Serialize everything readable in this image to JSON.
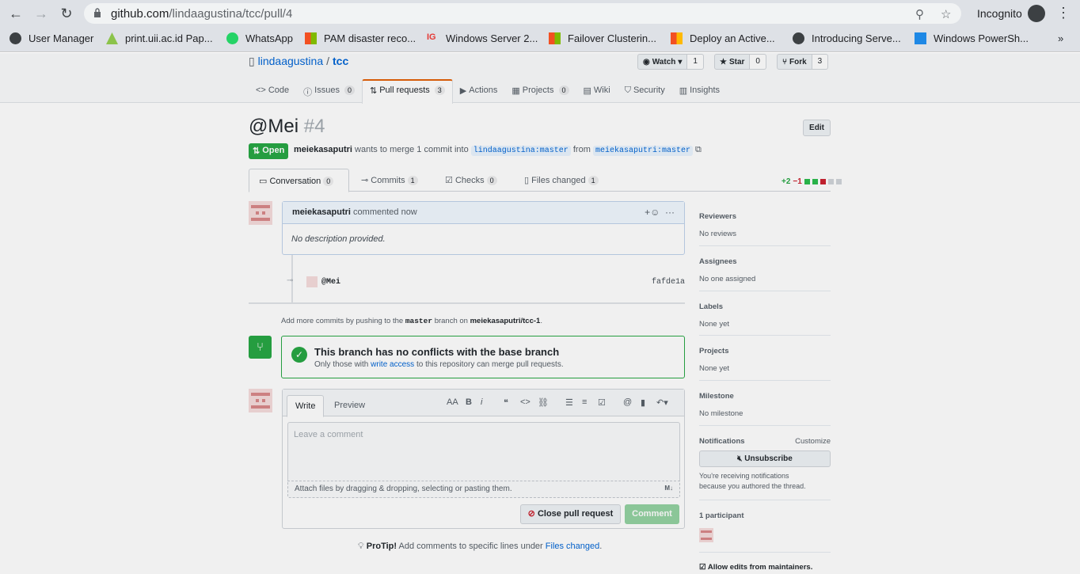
{
  "browser": {
    "url_host": "github.com",
    "url_path": "/lindaagustina/tcc/pull/4",
    "mode_label": "Incognito",
    "bookmarks": [
      {
        "label": "User Manager",
        "icon": "globe-icon"
      },
      {
        "label": "print.uii.ac.id Pap...",
        "icon": "papercut-icon"
      },
      {
        "label": "WhatsApp",
        "icon": "whatsapp-icon"
      },
      {
        "label": "PAM disaster reco...",
        "icon": "microsoft-icon"
      },
      {
        "label": "Windows Server 2...",
        "icon": "ig-icon"
      },
      {
        "label": "Failover Clusterin...",
        "icon": "microsoft-icon"
      },
      {
        "label": "Deploy an Active...",
        "icon": "microsoft-icon"
      },
      {
        "label": "Introducing Serve...",
        "icon": "globe-icon"
      },
      {
        "label": "Windows PowerSh...",
        "icon": "itpro-icon"
      }
    ],
    "more_label": "»"
  },
  "repo": {
    "owner": "lindaagustina",
    "name": "tcc",
    "watch": {
      "label": "Watch",
      "count": "1"
    },
    "star": {
      "label": "Star",
      "count": "0"
    },
    "fork": {
      "label": "Fork",
      "count": "3"
    },
    "tabs": [
      {
        "label": "Code",
        "count": null
      },
      {
        "label": "Issues",
        "count": "0"
      },
      {
        "label": "Pull requests",
        "count": "3"
      },
      {
        "label": "Actions",
        "count": null
      },
      {
        "label": "Projects",
        "count": "0"
      },
      {
        "label": "Wiki",
        "count": null
      },
      {
        "label": "Security",
        "count": null
      },
      {
        "label": "Insights",
        "count": null
      }
    ]
  },
  "pr": {
    "title": "@Mei",
    "number": "#4",
    "edit_label": "Edit",
    "state": "Open",
    "author": "meiekasaputri",
    "merge_text": "wants to merge 1 commit into",
    "base_ref": "lindaagustina:master",
    "from_text": "from",
    "head_ref": "meiekasaputri:master",
    "tabs": [
      {
        "label": "Conversation",
        "count": "0"
      },
      {
        "label": "Commits",
        "count": "1"
      },
      {
        "label": "Checks",
        "count": "0"
      },
      {
        "label": "Files changed",
        "count": "1"
      }
    ],
    "diff_add": "+2",
    "diff_del": "−1"
  },
  "comment": {
    "author": "meiekasaputri",
    "action": "commented now",
    "body": "No description provided."
  },
  "commit": {
    "message": "@Mei",
    "sha": "fafde1a"
  },
  "add_more": {
    "prefix": "Add more commits by pushing to the",
    "branch": "master",
    "middle": "branch on",
    "repo": "meiekasaputri/tcc-1",
    "suffix": "."
  },
  "merge": {
    "title": "This branch has no conflicts with the base branch",
    "sub_prefix": "Only those with",
    "sub_link": "write access",
    "sub_suffix": "to this repository can merge pull requests."
  },
  "editor": {
    "write_tab": "Write",
    "preview_tab": "Preview",
    "placeholder": "Leave a comment",
    "attach": "Attach files by dragging & dropping, selecting or pasting them.",
    "close_label": "Close pull request",
    "comment_label": "Comment"
  },
  "protip": {
    "bold": "ProTip!",
    "text": "Add comments to specific lines under",
    "link": "Files changed",
    "end": "."
  },
  "sidebar": {
    "reviewers": {
      "label": "Reviewers",
      "value": "No reviews"
    },
    "assignees": {
      "label": "Assignees",
      "value": "No one assigned"
    },
    "labels": {
      "label": "Labels",
      "value": "None yet"
    },
    "projects": {
      "label": "Projects",
      "value": "None yet"
    },
    "milestone": {
      "label": "Milestone",
      "value": "No milestone"
    },
    "notifications": {
      "label": "Notifications",
      "customize": "Customize",
      "button": "Unsubscribe",
      "note_1": "You're receiving notifications",
      "note_2": "because you authored the thread."
    },
    "participants": {
      "label": "1 participant"
    },
    "allow_edits": "Allow edits from maintainers."
  },
  "colors": {
    "accent": "#0366d6",
    "open": "#28a745",
    "tab_border": "#e36209"
  }
}
